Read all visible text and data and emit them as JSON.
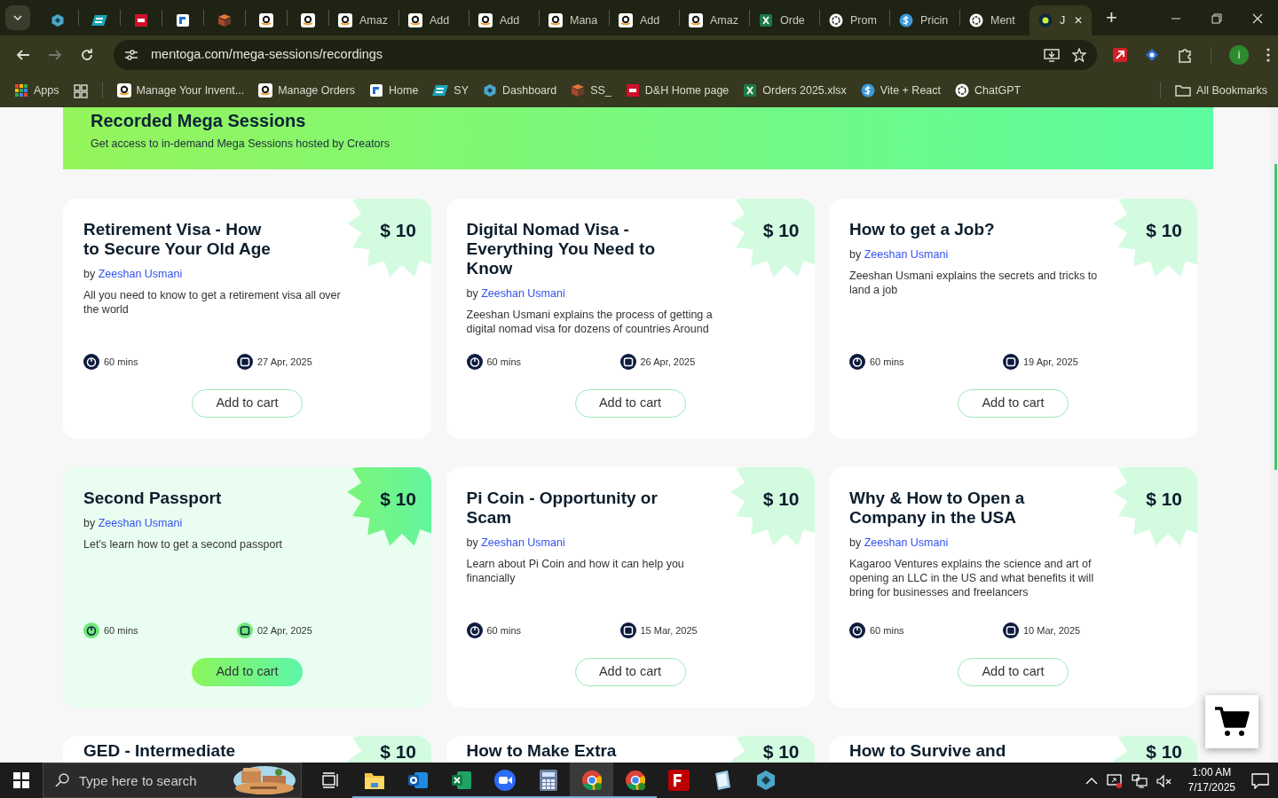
{
  "browser": {
    "tabs": [
      {
        "kind": "hex",
        "selected": false
      },
      {
        "kind": "ec",
        "selected": false
      },
      {
        "kind": "dh",
        "selected": false
      },
      {
        "kind": "g",
        "selected": false
      },
      {
        "kind": "ss",
        "selected": false
      },
      {
        "kind": "amazon",
        "selected": false
      },
      {
        "kind": "amazon",
        "selected": false
      },
      {
        "kind": "amazon",
        "label": "Amaz",
        "selected": false
      },
      {
        "kind": "amazon",
        "label": "Add",
        "selected": false
      },
      {
        "kind": "amazon",
        "label": "Add",
        "selected": false
      },
      {
        "kind": "amazon",
        "label": "Mana",
        "selected": false
      },
      {
        "kind": "amazon",
        "label": "Add",
        "selected": false
      },
      {
        "kind": "amazon",
        "label": "Amaz",
        "selected": false
      },
      {
        "kind": "excel",
        "label": "Orde",
        "selected": false
      },
      {
        "kind": "openai",
        "label": "Prom",
        "selected": false
      },
      {
        "kind": "dollar",
        "label": "Pricin",
        "selected": false
      },
      {
        "kind": "openai",
        "label": "Ment",
        "selected": false
      },
      {
        "kind": "dot",
        "label": "J",
        "selected": true
      }
    ],
    "close_tab": "✕",
    "new_tab": "+",
    "address": "mentoga.com/mega-sessions/recordings",
    "forward_disabled": true,
    "profile_initial": "i",
    "bookmarks": [
      {
        "kind": "apps",
        "label": "Apps"
      },
      {
        "kind": "amazon",
        "label": "Manage Your Invent..."
      },
      {
        "kind": "amazon",
        "label": "Manage Orders"
      },
      {
        "kind": "g",
        "label": "Home"
      },
      {
        "kind": "ec",
        "label": "SY"
      },
      {
        "kind": "hex",
        "label": "Dashboard"
      },
      {
        "kind": "ss",
        "label": "SS_"
      },
      {
        "kind": "dh",
        "label": "D&H Home page"
      },
      {
        "kind": "excel",
        "label": "Orders 2025.xlsx"
      },
      {
        "kind": "dollar",
        "label": "Vite + React"
      },
      {
        "kind": "openai",
        "label": "ChatGPT"
      }
    ],
    "all_bookmarks": "All Bookmarks"
  },
  "page": {
    "banner": {
      "title": "Recorded Mega Sessions",
      "subtitle": "Get access to in-demand Mega Sessions hosted by Creators"
    },
    "cards": [
      {
        "title": "Retirement Visa - How to Secure Your Old Age",
        "by": "by",
        "author": "Zeeshan Usmani",
        "description": "All you need to know to get a retirement visa all over the world",
        "duration": "60 mins",
        "date": "27 Apr, 2025",
        "price": "$ 10",
        "button": "Add to cart",
        "hovered": false
      },
      {
        "title": "Digital Nomad Visa - Everything You Need to Know",
        "by": "by",
        "author": "Zeeshan Usmani",
        "description": "Zeeshan Usmani explains the process of getting a digital nomad visa for dozens of countries Around",
        "duration": "60 mins",
        "date": "26 Apr, 2025",
        "price": "$ 10",
        "button": "Add to cart",
        "hovered": false
      },
      {
        "title": "How to get a Job?",
        "by": "by",
        "author": "Zeeshan Usmani",
        "description": "Zeeshan Usmani explains the secrets and tricks to land a job",
        "duration": "60 mins",
        "date": "19 Apr, 2025",
        "price": "$ 10",
        "button": "Add to cart",
        "hovered": false
      },
      {
        "title": "Second Passport",
        "by": "by",
        "author": "Zeeshan Usmani",
        "description": "Let's learn how to get a second passport",
        "duration": "60 mins",
        "date": "02 Apr, 2025",
        "price": "$ 10",
        "button": "Add to cart",
        "hovered": true
      },
      {
        "title": "Pi Coin - Opportunity or Scam",
        "by": "by",
        "author": "Zeeshan Usmani",
        "description": "Learn about Pi Coin and how it can help you financially",
        "duration": "60 mins",
        "date": "15 Mar, 2025",
        "price": "$ 10",
        "button": "Add to cart",
        "hovered": false
      },
      {
        "title": "Why & How to Open a Company in the USA",
        "by": "by",
        "author": "Zeeshan Usmani",
        "description": "Kagaroo Ventures explains the science and art of opening an LLC in the US and what benefits it will bring for businesses and freelancers",
        "duration": "60 mins",
        "date": "10 Mar, 2025",
        "price": "$ 10",
        "button": "Add to cart",
        "hovered": false
      }
    ],
    "more_cards": [
      {
        "title": "GED - Intermediate",
        "price": "$ 10"
      },
      {
        "title": "How to Make Extra",
        "price": "$ 10"
      },
      {
        "title": "How to Survive and",
        "price": "$ 10"
      }
    ]
  },
  "taskbar": {
    "search_placeholder": "Type here to search",
    "apps": [
      {
        "kind": "explorer",
        "running": true,
        "selected": false
      },
      {
        "kind": "outlook",
        "running": true,
        "selected": false
      },
      {
        "kind": "excel",
        "running": true,
        "selected": false
      },
      {
        "kind": "zoom",
        "running": true,
        "selected": false
      },
      {
        "kind": "calculator",
        "running": true,
        "selected": false
      },
      {
        "kind": "chrome",
        "running": true,
        "selected": true
      },
      {
        "kind": "chrome",
        "running": true,
        "selected": false
      },
      {
        "kind": "filezilla",
        "running": false,
        "selected": false
      },
      {
        "kind": "notepad",
        "running": false,
        "selected": false
      },
      {
        "kind": "hexapp",
        "running": false,
        "selected": false
      }
    ],
    "time": "1:00 AM",
    "date": "7/17/2025"
  }
}
